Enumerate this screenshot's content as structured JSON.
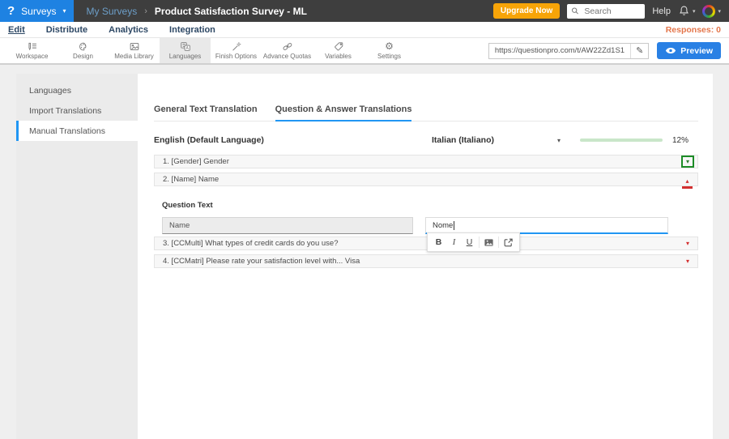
{
  "topbar": {
    "logo_glyph": "?",
    "product_menu": "Surveys",
    "breadcrumb": {
      "parent": "My Surveys",
      "separator": "›",
      "current": "Product Satisfaction Survey - ML"
    },
    "upgrade_button": "Upgrade Now",
    "search_placeholder": "Search",
    "help_label": "Help"
  },
  "subnav": {
    "items": [
      {
        "label": "Edit",
        "active": true
      },
      {
        "label": "Distribute",
        "active": false
      },
      {
        "label": "Analytics",
        "active": false
      },
      {
        "label": "Integration",
        "active": false
      }
    ],
    "responses_label": "Responses: 0"
  },
  "survey_toolbar": {
    "items": [
      {
        "label": "Workspace",
        "active": false
      },
      {
        "label": "Design",
        "active": false
      },
      {
        "label": "Media Library",
        "active": false
      },
      {
        "label": "Languages",
        "active": true
      },
      {
        "label": "Finish Options",
        "active": false
      },
      {
        "label": "Advance Quotas",
        "active": false
      },
      {
        "label": "Variables",
        "active": false
      },
      {
        "label": "Settings",
        "active": false
      }
    ],
    "share_url": "https://questionpro.com/t/AW22Zd1S1",
    "preview_button": "Preview"
  },
  "sidebar": {
    "items": [
      {
        "label": "Languages",
        "active": false
      },
      {
        "label": "Import Translations",
        "active": false
      },
      {
        "label": "Manual Translations",
        "active": true
      }
    ]
  },
  "main": {
    "tabs": [
      {
        "label": "General Text Translation",
        "active": false
      },
      {
        "label": "Question & Answer Translations",
        "active": true
      }
    ],
    "source_language": "English (Default Language)",
    "target_language": "Italian (Italiano)",
    "progress_percent": "12%",
    "progress_value": 12,
    "progress_style": "width:12%",
    "questions": [
      {
        "label": "1. [Gender] Gender",
        "state": "collapsed",
        "highlighted": true
      },
      {
        "label": "2. [Name] Name",
        "state": "expanded",
        "highlighted": false
      },
      {
        "label": "3. [CCMulti] What types of credit cards do you use?",
        "state": "collapsed",
        "highlighted": false
      },
      {
        "label": "4. [CCMatri] Please rate your satisfaction level with... Visa",
        "state": "collapsed",
        "highlighted": false
      }
    ],
    "editor": {
      "section_label": "Question Text",
      "source_text": "Name",
      "translation_text": "Nome",
      "toolbar": {
        "bold": "B",
        "italic": "I",
        "underline": "U"
      }
    }
  },
  "icons": {
    "caret_down": "▾",
    "caret_up": "▴",
    "pencil": "✎",
    "gear": "⚙"
  },
  "colors": {
    "brand_blue": "#1e82e2",
    "header_dark": "#3e3e3e",
    "upgrade_orange": "#f7a408",
    "responses_orange": "#e4764b",
    "accent_blue": "#2196f3",
    "preview_blue": "#2980e4",
    "progress_green": "#3c9e42",
    "caret_red": "#d32f2f",
    "highlight_green": "#1d8c27"
  }
}
